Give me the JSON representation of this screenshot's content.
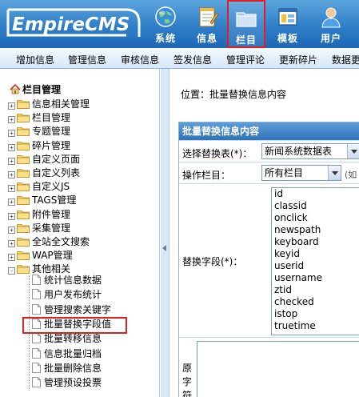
{
  "brand": {
    "logo_text": "EmpireCMS"
  },
  "nav": [
    {
      "label": "系统",
      "icon": "globe-icon"
    },
    {
      "label": "信息",
      "icon": "notepad-icon"
    },
    {
      "label": "栏目",
      "icon": "folder-icon",
      "active": true
    },
    {
      "label": "模板",
      "icon": "window-template-icon"
    },
    {
      "label": "用户",
      "icon": "user-icon"
    }
  ],
  "submenu": [
    "增加信息",
    "管理信息",
    "审核信息",
    "签发信息",
    "管理评论",
    "更新碎片",
    "数据更"
  ],
  "tree": {
    "root": "栏目管理",
    "nodes": [
      {
        "label": "信息相关管理",
        "state": "+"
      },
      {
        "label": "栏目管理",
        "state": "+"
      },
      {
        "label": "专题管理",
        "state": "+"
      },
      {
        "label": "碎片管理",
        "state": "+"
      },
      {
        "label": "自定义页面",
        "state": "+"
      },
      {
        "label": "自定义列表",
        "state": "+"
      },
      {
        "label": "自定义JS",
        "state": "+"
      },
      {
        "label": "TAGS管理",
        "state": "+"
      },
      {
        "label": "附件管理",
        "state": "+"
      },
      {
        "label": "采集管理",
        "state": "+"
      },
      {
        "label": "全站全文搜索",
        "state": "+"
      },
      {
        "label": "WAP管理",
        "state": "+"
      },
      {
        "label": "其他相关",
        "state": "-"
      }
    ],
    "children": [
      {
        "label": "统计信息数据"
      },
      {
        "label": "用户发布统计"
      },
      {
        "label": "管理搜索关键字"
      },
      {
        "label": "批量替换字段值",
        "highlighted": true
      },
      {
        "label": "批量转移信息"
      },
      {
        "label": "信息批量归档"
      },
      {
        "label": "批量删除信息"
      },
      {
        "label": "管理预设投票"
      }
    ]
  },
  "main": {
    "location": "位置：批量替换信息内容",
    "form_title": "批量替换信息内容",
    "table_label": "选择替换表(*)：",
    "table_value": "新闻系统数据表",
    "column_label": "操作栏目：",
    "column_value": "所有栏目",
    "column_hint": "(如",
    "field_label": "替换字段(*)：",
    "fields": [
      "id",
      "classid",
      "onclick",
      "newspath",
      "keyboard",
      "keyid",
      "userid",
      "username",
      "ztid",
      "checked",
      "istop",
      "truetime"
    ],
    "orig_label": "原字符"
  },
  "colors": {
    "header": "#2f7ec8",
    "active_outline": "#e02020",
    "form_title_bg": "#2f73b8"
  }
}
